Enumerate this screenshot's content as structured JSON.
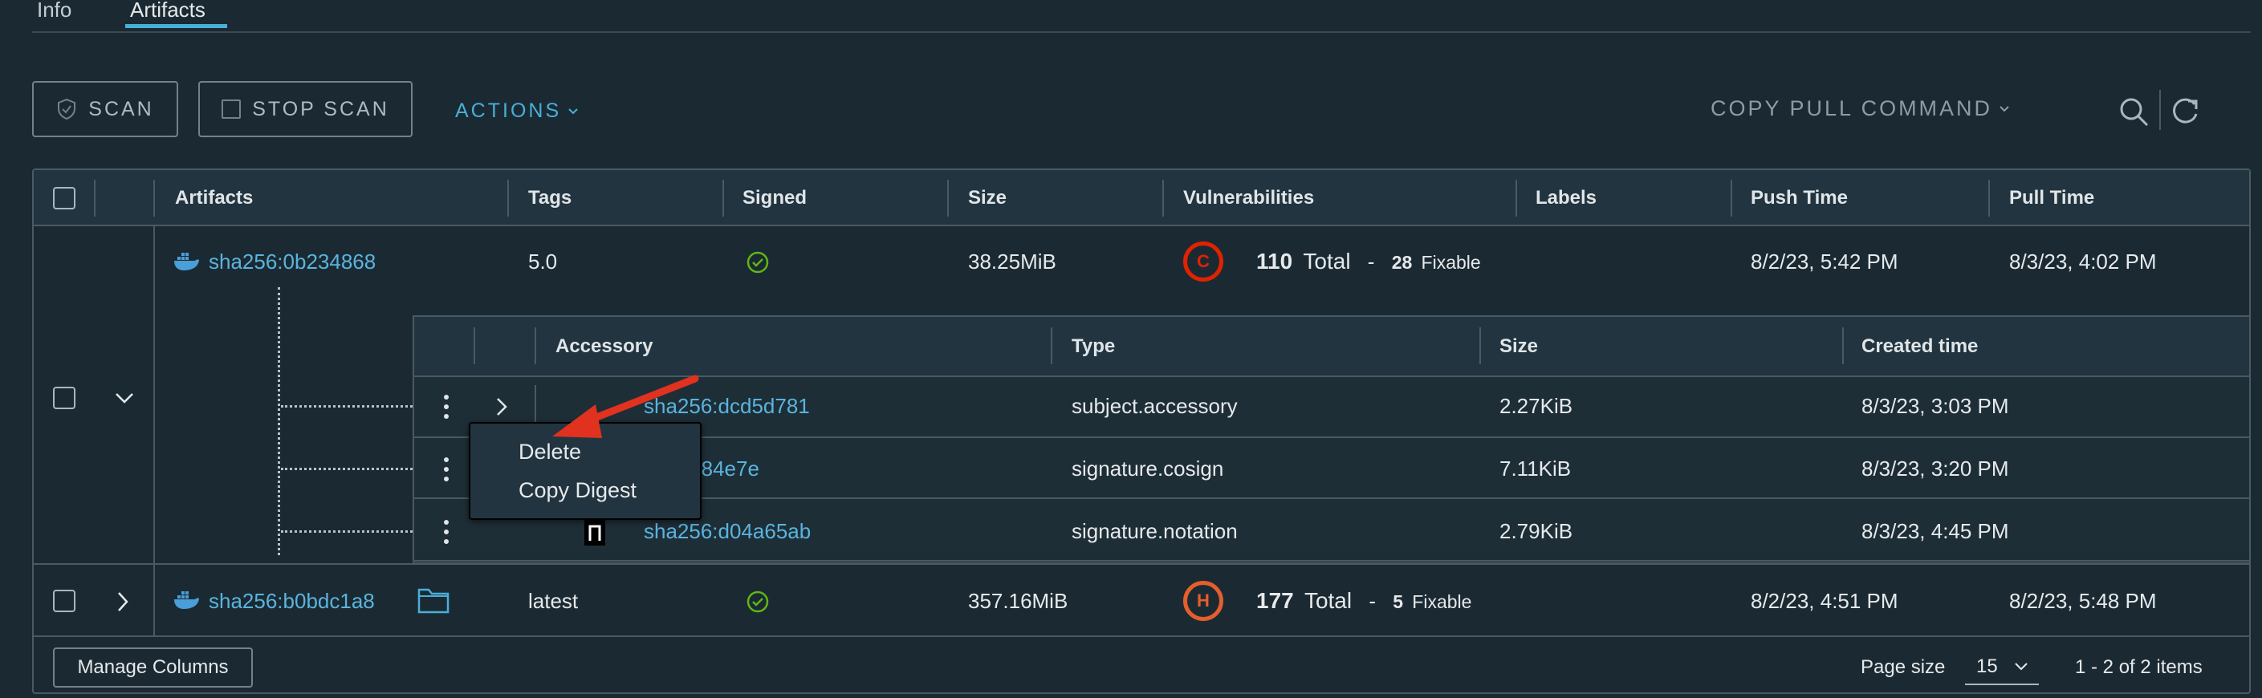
{
  "tabs": [
    {
      "label": "Info"
    },
    {
      "label": "Artifacts"
    }
  ],
  "toolbar": {
    "scan_label": "SCAN",
    "stop_scan_label": "STOP SCAN",
    "actions_label": "ACTIONS",
    "copy_pull_label": "COPY PULL COMMAND"
  },
  "columns": [
    "Artifacts",
    "Tags",
    "Signed",
    "Size",
    "Vulnerabilities",
    "Labels",
    "Push Time",
    "Pull Time"
  ],
  "rows": [
    {
      "digest": "sha256:0b234868",
      "tag": "5.0",
      "size": "38.25MiB",
      "severity": "C",
      "vuln_total": "110",
      "total_label": "Total",
      "dash": "-",
      "fixable_count": "28",
      "fixable_label": "Fixable",
      "push_time": "8/2/23, 5:42 PM",
      "pull_time": "8/3/23, 4:02 PM"
    },
    {
      "digest": "sha256:b0bdc1a8",
      "tag": "latest",
      "size": "357.16MiB",
      "severity": "H",
      "vuln_total": "177",
      "total_label": "Total",
      "dash": "-",
      "fixable_count": "5",
      "fixable_label": "Fixable",
      "push_time": "8/2/23, 4:51 PM",
      "pull_time": "8/2/23, 5:48 PM"
    }
  ],
  "accessory": {
    "columns": [
      "Accessory",
      "Type",
      "Size",
      "Created time"
    ],
    "rows": [
      {
        "digest": "sha256:dcd5d781",
        "type": "subject.accessory",
        "size": "2.27KiB",
        "created": "8/3/23, 3:03 PM"
      },
      {
        "digest": "6:6c284e7e",
        "type": "signature.cosign",
        "size": "7.11KiB",
        "created": "8/3/23, 3:20 PM"
      },
      {
        "digest": "sha256:d04a65ab",
        "type": "signature.notation",
        "size": "2.79KiB",
        "created": "8/3/23, 4:45 PM"
      }
    ]
  },
  "context_menu": {
    "items": [
      "Delete",
      "Copy Digest"
    ]
  },
  "footer": {
    "manage_columns": "Manage Columns",
    "page_size_label": "Page size",
    "page_size_value": "15",
    "items_text": "1 - 2 of 2 items"
  },
  "colors": {
    "accent": "#49afd9",
    "critical": "#e12200",
    "high": "#e65e2c",
    "ok": "#5eb715"
  }
}
